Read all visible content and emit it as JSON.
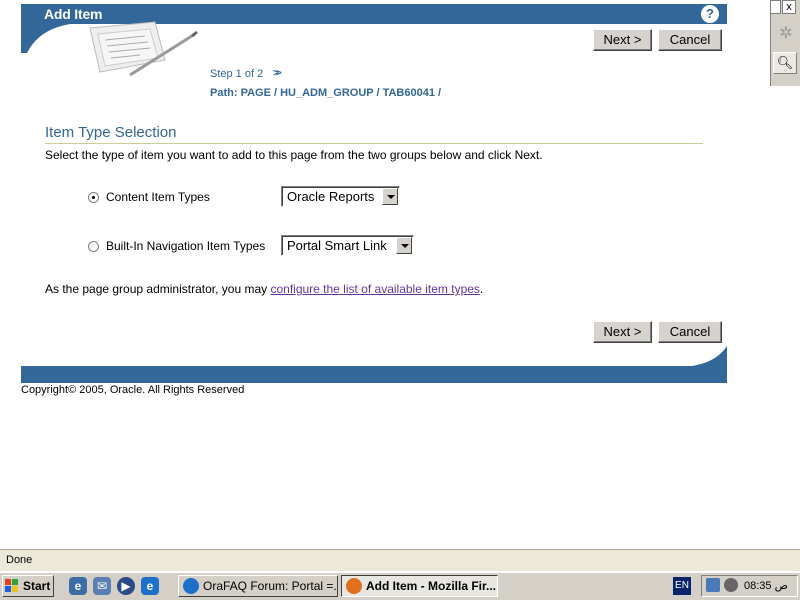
{
  "header": {
    "title": "Add Item",
    "help_symbol": "?"
  },
  "wizard": {
    "next_label": "Next >",
    "cancel_label": "Cancel",
    "step": "Step 1 of 2",
    "step_arrows": ">>",
    "path_label": "Path:",
    "path": "PAGE / HU_ADM_GROUP / TAB60041 /"
  },
  "section": {
    "heading": "Item Type Selection",
    "instructions": "Select the type of item you want to add to this page from the two groups below and click Next."
  },
  "options": {
    "content": {
      "label": "Content Item Types",
      "selected": true,
      "select_value": "Oracle Reports"
    },
    "builtin": {
      "label": "Built-In Navigation Item Types",
      "selected": false,
      "select_value": "Portal Smart Link"
    }
  },
  "admin": {
    "text_before": "As the page group administrator, you may ",
    "link": "configure the list of available item types",
    "text_after": "."
  },
  "footer": {
    "copyright": "Copyright© 2005, Oracle. All Rights Reserved"
  },
  "browser": {
    "status": "Done",
    "side_close": "x"
  },
  "taskbar": {
    "start_label": "Start",
    "tasks": [
      {
        "label": "OraFAQ Forum: Portal =...",
        "active": false
      },
      {
        "label": "Add Item - Mozilla Fir...",
        "active": true
      }
    ],
    "language": "EN",
    "clock": "08:35 ص"
  },
  "colors": {
    "portal_blue": "#336699",
    "link_visited": "#663399",
    "rule": "#cccc99",
    "chrome": "#d4d0c8"
  }
}
